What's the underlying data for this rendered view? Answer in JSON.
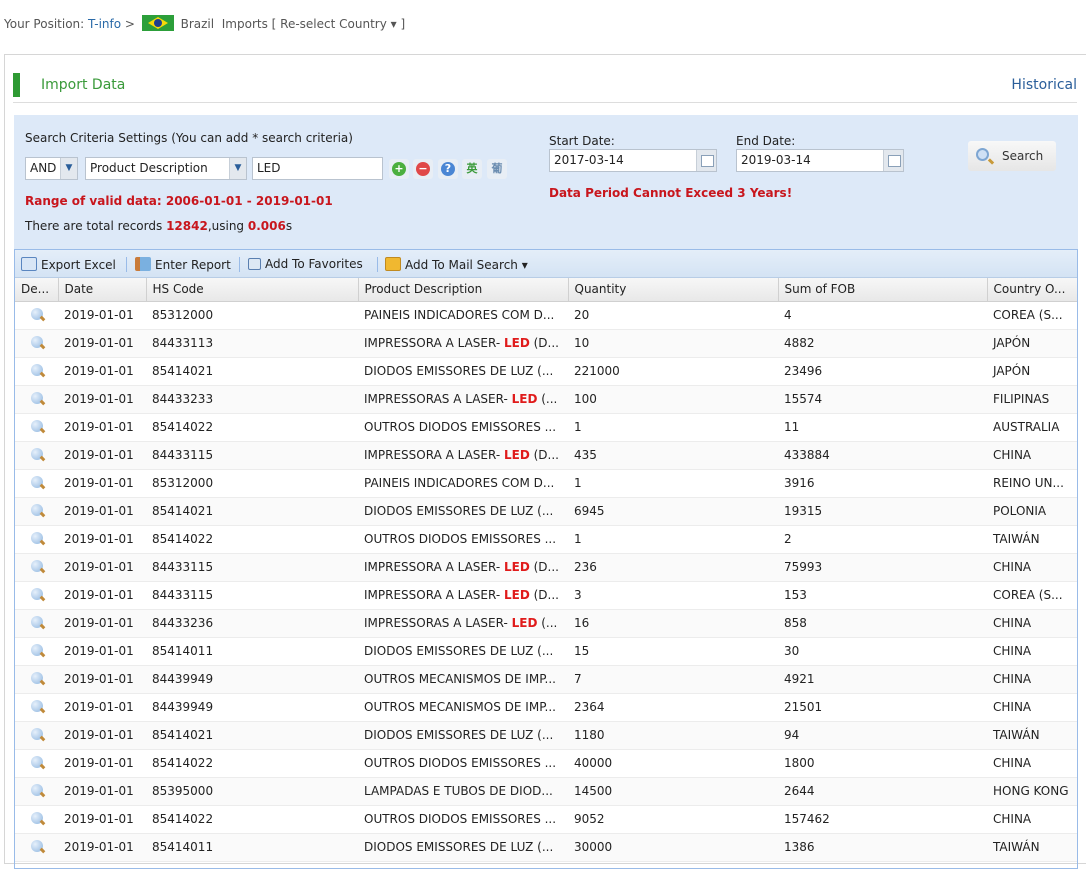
{
  "breadcrumb": {
    "prefix": "Your Position: ",
    "home": "T-info",
    "separator": " > ",
    "country": "Brazil",
    "trade": "Imports",
    "reselect": "[ Re-select Country ▾ ]"
  },
  "panel": {
    "title": "Import Data",
    "historical_link": "Historical",
    "accent_color": "#2e9a33"
  },
  "search": {
    "criteria_label": "Search Criteria Settings (You can add * search criteria)",
    "logic_value": "AND",
    "field_value": "Product Description",
    "keyword_value": "LED",
    "icons": [
      "add-criteria",
      "remove-criteria",
      "help",
      "english",
      "portuguese"
    ],
    "lang_en": "英",
    "lang_pt": "葡",
    "range_text": "Range of valid data: 2006-01-01 - 2019-01-01",
    "total_prefix": "There are total records ",
    "total_count": "12842",
    "total_mid": ",using ",
    "total_time": "0.006",
    "total_suffix": "s",
    "start_label": "Start Date:",
    "start_value": "2017-03-14",
    "end_label": "End Date:",
    "end_value": "2019-03-14",
    "warning": "Data Period Cannot Exceed 3 Years!",
    "search_button": "Search"
  },
  "toolbar": {
    "export_excel": "Export Excel",
    "enter_report": "Enter Report",
    "add_favorites": "Add To Favorites",
    "add_mail_search": "Add To Mail Search ▾"
  },
  "table": {
    "columns": [
      "De...",
      "Date",
      "HS Code",
      "Product Description",
      "Quantity",
      "Sum of FOB",
      "Country O..."
    ],
    "rows": [
      {
        "date": "2019-01-01",
        "hs": "85312000",
        "desc_pre": "PAINEIS INDICADORES COM D...",
        "desc_hl": "",
        "desc_post": "",
        "qty": "20",
        "fob": "4",
        "country": "COREA (S..."
      },
      {
        "date": "2019-01-01",
        "hs": "84433113",
        "desc_pre": "IMPRESSORA A LASER- ",
        "desc_hl": "LED",
        "desc_post": " (D...",
        "qty": "10",
        "fob": "4882",
        "country": "JAPÓN"
      },
      {
        "date": "2019-01-01",
        "hs": "85414021",
        "desc_pre": "DIODOS EMISSORES DE LUZ (...",
        "desc_hl": "",
        "desc_post": "",
        "qty": "221000",
        "fob": "23496",
        "country": "JAPÓN"
      },
      {
        "date": "2019-01-01",
        "hs": "84433233",
        "desc_pre": "IMPRESSORAS A LASER- ",
        "desc_hl": "LED",
        "desc_post": " (...",
        "qty": "100",
        "fob": "15574",
        "country": "FILIPINAS"
      },
      {
        "date": "2019-01-01",
        "hs": "85414022",
        "desc_pre": "OUTROS DIODOS EMISSORES ...",
        "desc_hl": "",
        "desc_post": "",
        "qty": "1",
        "fob": "11",
        "country": "AUSTRALIA"
      },
      {
        "date": "2019-01-01",
        "hs": "84433115",
        "desc_pre": "IMPRESSORA A LASER- ",
        "desc_hl": "LED",
        "desc_post": " (D...",
        "qty": "435",
        "fob": "433884",
        "country": "CHINA"
      },
      {
        "date": "2019-01-01",
        "hs": "85312000",
        "desc_pre": "PAINEIS INDICADORES COM D...",
        "desc_hl": "",
        "desc_post": "",
        "qty": "1",
        "fob": "3916",
        "country": "REINO UN..."
      },
      {
        "date": "2019-01-01",
        "hs": "85414021",
        "desc_pre": "DIODOS EMISSORES DE LUZ (...",
        "desc_hl": "",
        "desc_post": "",
        "qty": "6945",
        "fob": "19315",
        "country": "POLONIA"
      },
      {
        "date": "2019-01-01",
        "hs": "85414022",
        "desc_pre": "OUTROS DIODOS EMISSORES ...",
        "desc_hl": "",
        "desc_post": "",
        "qty": "1",
        "fob": "2",
        "country": "TAIWÁN"
      },
      {
        "date": "2019-01-01",
        "hs": "84433115",
        "desc_pre": "IMPRESSORA A LASER- ",
        "desc_hl": "LED",
        "desc_post": " (D...",
        "qty": "236",
        "fob": "75993",
        "country": "CHINA"
      },
      {
        "date": "2019-01-01",
        "hs": "84433115",
        "desc_pre": "IMPRESSORA A LASER- ",
        "desc_hl": "LED",
        "desc_post": " (D...",
        "qty": "3",
        "fob": "153",
        "country": "COREA (S..."
      },
      {
        "date": "2019-01-01",
        "hs": "84433236",
        "desc_pre": "IMPRESSORAS A LASER- ",
        "desc_hl": "LED",
        "desc_post": " (...",
        "qty": "16",
        "fob": "858",
        "country": "CHINA"
      },
      {
        "date": "2019-01-01",
        "hs": "85414011",
        "desc_pre": "DIODOS EMISSORES DE LUZ (...",
        "desc_hl": "",
        "desc_post": "",
        "qty": "15",
        "fob": "30",
        "country": "CHINA"
      },
      {
        "date": "2019-01-01",
        "hs": "84439949",
        "desc_pre": "OUTROS MECANISMOS DE IMP...",
        "desc_hl": "",
        "desc_post": "",
        "qty": "7",
        "fob": "4921",
        "country": "CHINA"
      },
      {
        "date": "2019-01-01",
        "hs": "84439949",
        "desc_pre": "OUTROS MECANISMOS DE IMP...",
        "desc_hl": "",
        "desc_post": "",
        "qty": "2364",
        "fob": "21501",
        "country": "CHINA"
      },
      {
        "date": "2019-01-01",
        "hs": "85414021",
        "desc_pre": "DIODOS EMISSORES DE LUZ (...",
        "desc_hl": "",
        "desc_post": "",
        "qty": "1180",
        "fob": "94",
        "country": "TAIWÁN"
      },
      {
        "date": "2019-01-01",
        "hs": "85414022",
        "desc_pre": "OUTROS DIODOS EMISSORES ...",
        "desc_hl": "",
        "desc_post": "",
        "qty": "40000",
        "fob": "1800",
        "country": "CHINA"
      },
      {
        "date": "2019-01-01",
        "hs": "85395000",
        "desc_pre": "LAMPADAS E TUBOS DE DIOD...",
        "desc_hl": "",
        "desc_post": "",
        "qty": "14500",
        "fob": "2644",
        "country": "HONG KONG"
      },
      {
        "date": "2019-01-01",
        "hs": "85414022",
        "desc_pre": "OUTROS DIODOS EMISSORES ...",
        "desc_hl": "",
        "desc_post": "",
        "qty": "9052",
        "fob": "157462",
        "country": "CHINA"
      },
      {
        "date": "2019-01-01",
        "hs": "85414011",
        "desc_pre": "DIODOS EMISSORES DE LUZ (...",
        "desc_hl": "",
        "desc_post": "",
        "qty": "30000",
        "fob": "1386",
        "country": "TAIWÁN"
      }
    ]
  }
}
